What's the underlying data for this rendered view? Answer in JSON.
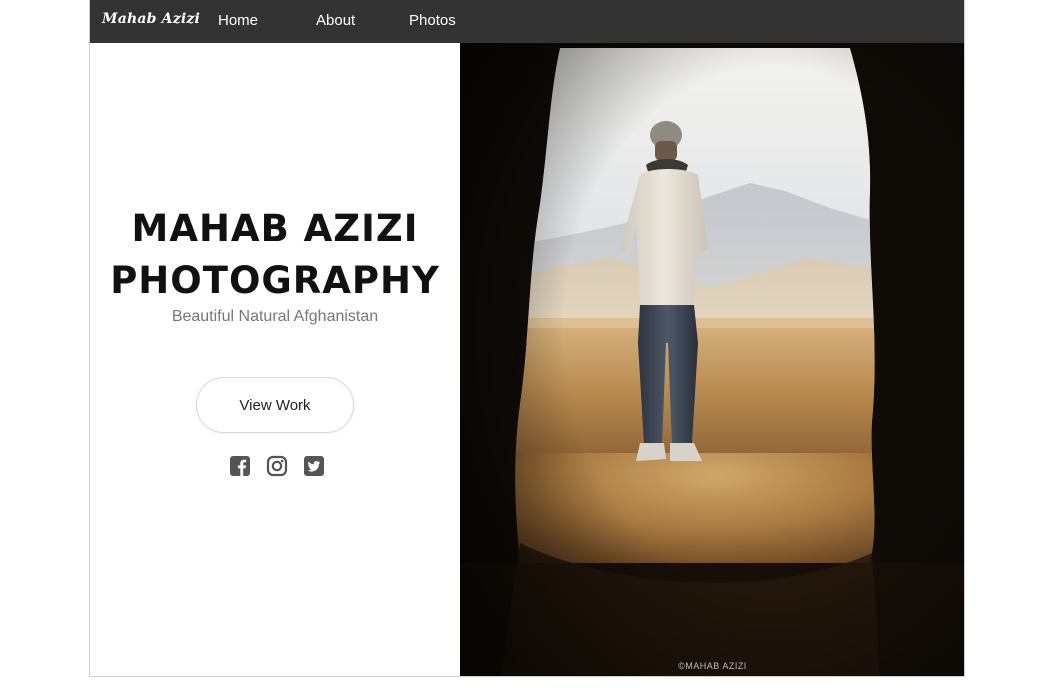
{
  "navbar": {
    "brand": "Mahab Azizi",
    "links": [
      "Home",
      "About",
      "Photos"
    ]
  },
  "hero": {
    "title_line1": "MAHAB AZIZI",
    "title_line2": "PHOTOGRAPHY",
    "subtitle": "Beautiful Natural Afghanistan",
    "cta_label": "View Work"
  },
  "social": {
    "icons": [
      "facebook-icon",
      "instagram-icon",
      "twitter-icon"
    ],
    "color": "#555555"
  },
  "photo": {
    "credit": "©MAHAB AZIZI"
  },
  "colors": {
    "navbar": "#333333",
    "nav_text": "#ffffff",
    "title": "#111111",
    "subtitle": "#777777"
  }
}
